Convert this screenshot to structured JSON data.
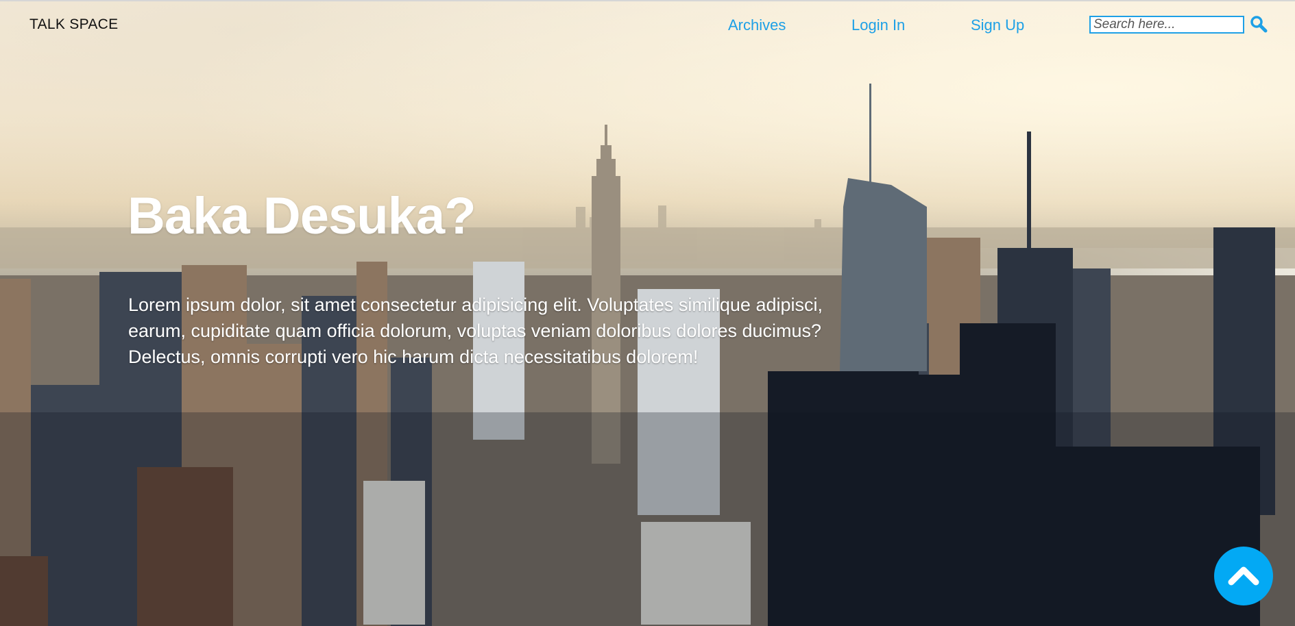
{
  "nav": {
    "brand": "TALK SPACE",
    "links": [
      {
        "label": "Archives"
      },
      {
        "label": "Login In"
      },
      {
        "label": "Sign Up"
      }
    ],
    "search": {
      "placeholder": "Search here...",
      "value": ""
    },
    "search_icon": "search-icon"
  },
  "hero": {
    "title": "Baka Desuka?",
    "body": "Lorem ipsum dolor, sit amet consectetur adipisicing elit. Voluptates similique adipisci, earum, cupiditate quam officia dolorum, voluptas veniam doloribus dolores ducimus? Delectus, omnis corrupti vero hic harum dicta necessitatibus dolorem!",
    "background": "city-skyline-photo"
  },
  "scroll_top": {
    "icon": "chevron-up-icon"
  },
  "colors": {
    "link": "#1ea0e6",
    "scroll_button": "#03a9f4",
    "brand_text": "#111111",
    "hero_text": "#ffffff"
  }
}
